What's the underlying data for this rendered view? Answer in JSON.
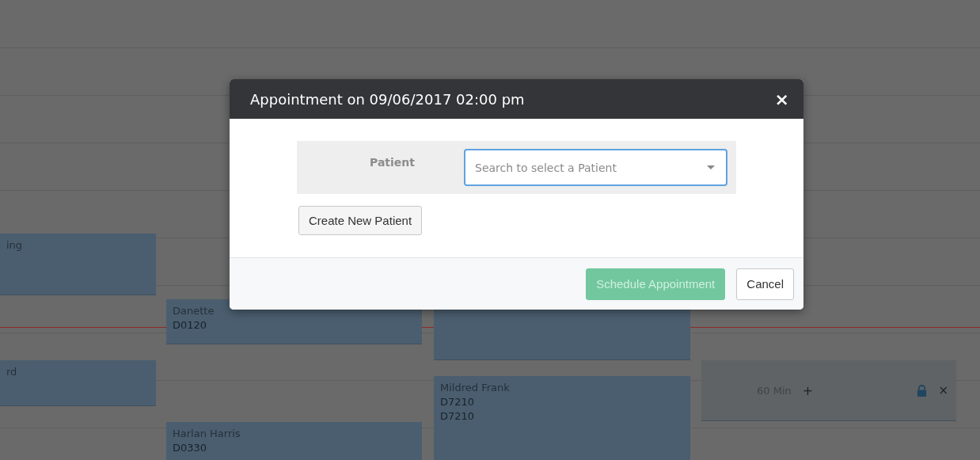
{
  "calendar": {
    "events": [
      {
        "kind": "appointment",
        "lines": [
          "ing"
        ]
      },
      {
        "kind": "appointment",
        "lines": [
          "Danette",
          "D0120"
        ]
      },
      {
        "kind": "appointment"
      },
      {
        "kind": "appointment",
        "lines": [
          "rd"
        ]
      },
      {
        "kind": "appointment",
        "lines": [
          "Mildred Frank",
          "D7210",
          "D7210"
        ]
      },
      {
        "kind": "appointment",
        "lines": [
          "Harlan Harris",
          "D0330"
        ]
      },
      {
        "kind": "open_slot",
        "duration": "60 Min",
        "add": "+",
        "remove": "×"
      }
    ]
  },
  "dialog": {
    "title": "Appointment on 09/06/2017 02:00 pm",
    "close": "×",
    "fields": [
      {
        "label": "Patient",
        "placeholder": "Search to select a Patient"
      }
    ],
    "create_button": "Create New Patient",
    "buttons": [
      {
        "label": "Schedule Appointment",
        "kind": "primary",
        "disabled": true
      },
      {
        "label": "Cancel",
        "kind": "default",
        "disabled": false
      }
    ]
  }
}
